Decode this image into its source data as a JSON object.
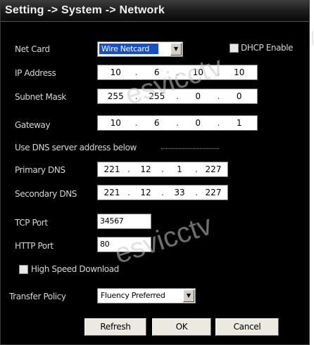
{
  "window": {
    "title": "Setting -> System -> Network"
  },
  "netcard": {
    "label": "Net Card",
    "value": "Wire Netcard"
  },
  "dhcp": {
    "label": "DHCP Enable",
    "checked": false
  },
  "ip_address": {
    "label": "IP Address",
    "octets": [
      "10",
      "6",
      "10",
      "10"
    ]
  },
  "subnet_mask": {
    "label": "Subnet Mask",
    "octets": [
      "255",
      "255",
      "0",
      "0"
    ]
  },
  "gateway": {
    "label": "Gateway",
    "octets": [
      "10",
      "6",
      "0",
      "1"
    ]
  },
  "dns_section": {
    "label": "Use DNS server address below"
  },
  "primary_dns": {
    "label": "Primary DNS",
    "octets": [
      "221",
      "12",
      "1",
      "227"
    ]
  },
  "secondary_dns": {
    "label": "Secondary DNS",
    "octets": [
      "221",
      "12",
      "33",
      "227"
    ]
  },
  "tcp_port": {
    "label": "TCP Port",
    "value": "34567"
  },
  "http_port": {
    "label": "HTTP Port",
    "value": "80"
  },
  "high_speed": {
    "label": "High Speed Download",
    "checked": false
  },
  "transfer_policy": {
    "label": "Transfer Policy",
    "value": "Fluency Preferred"
  },
  "buttons": {
    "refresh": "Refresh",
    "ok": "OK",
    "cancel": "Cancel"
  },
  "watermark": {
    "text": "esvicctv"
  },
  "colors": {
    "background": "#000000",
    "label_text": "#d6d6d6",
    "selection": "#1a4fc4"
  }
}
